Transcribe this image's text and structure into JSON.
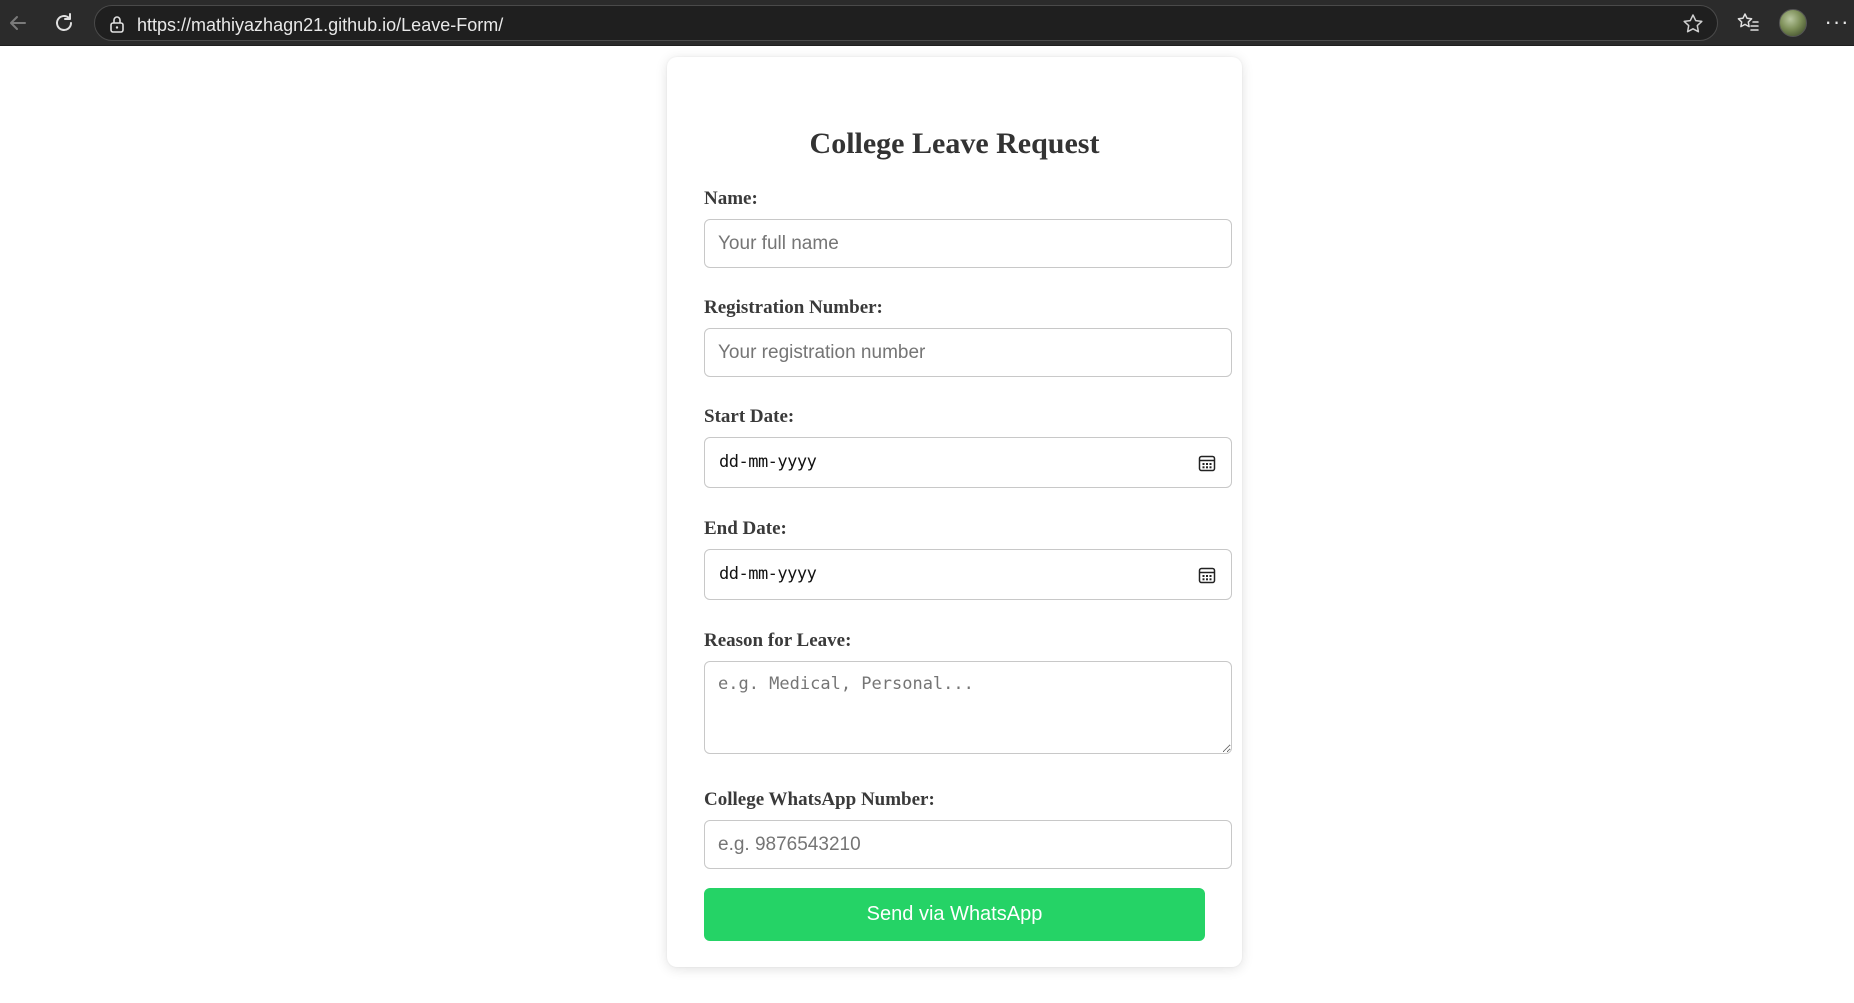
{
  "browser": {
    "url": "https://mathiyazhagn21.github.io/Leave-Form/",
    "icons": [
      "back-arrow-icon",
      "reload-icon",
      "lock-icon",
      "star-icon",
      "favorites-icon",
      "more-icon"
    ]
  },
  "form": {
    "title": "College Leave Request",
    "name": {
      "label": "Name:",
      "placeholder": "Your full name"
    },
    "registration": {
      "label": "Registration Number:",
      "placeholder": "Your registration number"
    },
    "start_date": {
      "label": "Start Date:",
      "value": "dd-mm-yyyy"
    },
    "end_date": {
      "label": "End Date:",
      "value": "dd-mm-yyyy"
    },
    "reason": {
      "label": "Reason for Leave:",
      "placeholder": "e.g. Medical, Personal..."
    },
    "whatsapp": {
      "label": "College WhatsApp Number:",
      "placeholder": "e.g. 9876543210"
    },
    "submit_label": "Send via WhatsApp"
  },
  "colors": {
    "button": "#25d366",
    "chrome_background": "#2b2b2b"
  }
}
